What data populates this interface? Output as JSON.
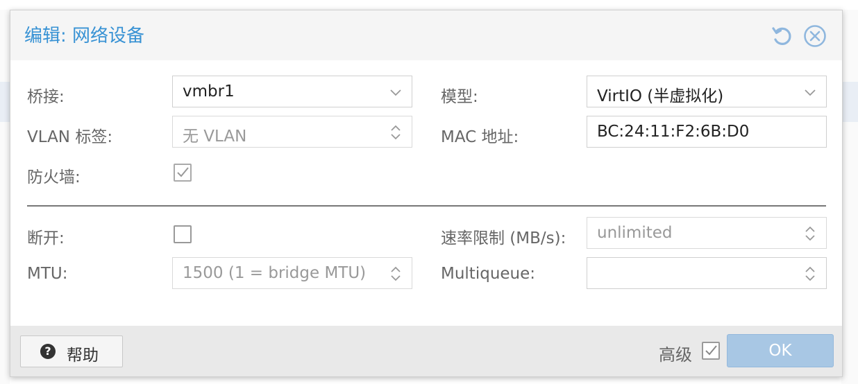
{
  "dialog": {
    "title": "编辑: 网络设备"
  },
  "form": {
    "bridge": {
      "label": "桥接:",
      "value": "vmbr1"
    },
    "model": {
      "label": "模型:",
      "value": "VirtIO (半虚拟化)"
    },
    "vlan": {
      "label": "VLAN 标签:",
      "placeholder": "无 VLAN"
    },
    "mac": {
      "label": "MAC 地址:",
      "value": "BC:24:11:F2:6B:D0"
    },
    "firewall": {
      "label": "防火墙:",
      "checked": true
    },
    "disconnect": {
      "label": "断开:",
      "checked": false
    },
    "rate": {
      "label": "速率限制 (MB/s):",
      "placeholder": "unlimited"
    },
    "mtu": {
      "label": "MTU:",
      "placeholder": "1500 (1 = bridge MTU)"
    },
    "multiqueue": {
      "label": "Multiqueue:",
      "value": ""
    }
  },
  "footer": {
    "help_label": "帮助",
    "advanced_label": "高级",
    "advanced_checked": true,
    "ok_label": "OK"
  },
  "colors": {
    "title": "#3892d4",
    "ok_button": "#a8c7e4"
  }
}
